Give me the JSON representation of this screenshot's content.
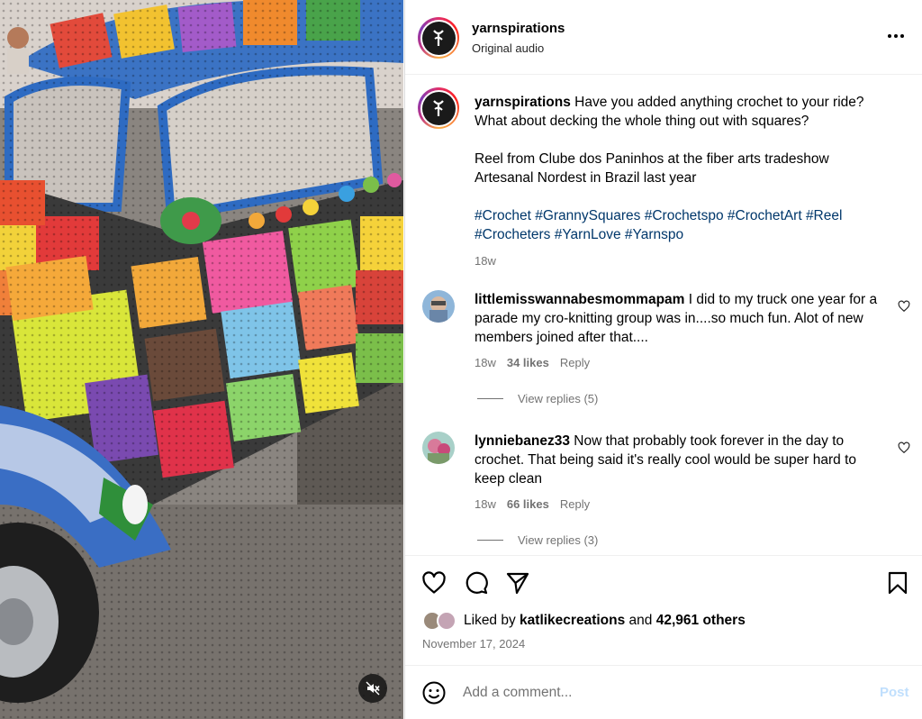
{
  "post": {
    "username": "yarnspirations",
    "audio": "Original audio",
    "caption_line1": "Have you added anything crochet to your ride?",
    "caption_line2": "What about decking the whole thing out with squares?",
    "caption_line3": "Reel from Clube dos Paninhos at the fiber arts tradeshow",
    "caption_line4": "Artesanal Nordest in Brazil last year",
    "hashtags": [
      "#Crochet",
      "#GrannySquares",
      "#Crochetspo",
      "#CrochetArt",
      "#Reel",
      "#Crocheters",
      "#YarnLove",
      "#Yarnspo"
    ],
    "age": "18w"
  },
  "comments": [
    {
      "username": "littlemisswannabesmommapam",
      "text": "I did to my truck one year for a parade my cro-knitting group was in....so much fun. Alot of new members joined after that....",
      "age": "18w",
      "likes": "34 likes",
      "reply": "Reply",
      "view_replies": "View replies (5)"
    },
    {
      "username": "lynniebanez33",
      "text": "Now that probably took forever in the day to crochet. That being said it's really cool would be super hard to keep clean",
      "age": "18w",
      "likes": "66 likes",
      "reply": "Reply",
      "view_replies": "View replies (3)"
    }
  ],
  "likes": {
    "prefix": "Liked by",
    "user": "katlikecreations",
    "and": "and",
    "others": "42,961 others"
  },
  "date": "November 17, 2024",
  "comment_box": {
    "placeholder": "Add a comment...",
    "post_label": "Post"
  },
  "icons": {
    "more": "more-options-icon",
    "like": "heart-icon",
    "comment": "comment-icon",
    "share": "share-icon",
    "save": "bookmark-icon",
    "emoji": "emoji-icon",
    "mute": "muted-speaker-icon"
  },
  "colors": {
    "link": "#00376b",
    "muted": "#737373",
    "post_disabled": "#c0dffd"
  }
}
